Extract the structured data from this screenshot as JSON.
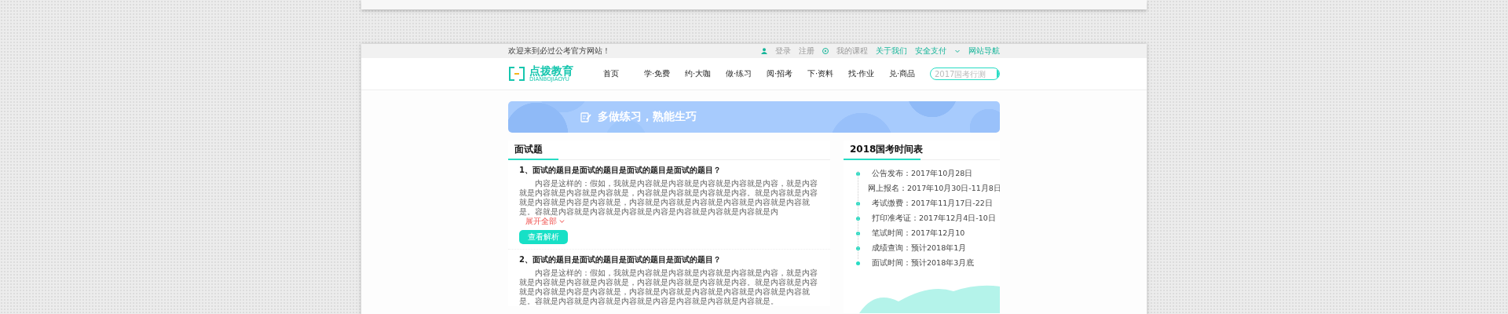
{
  "top_bar": {
    "welcome": "欢迎来到必过公考官方网站！",
    "links": [
      {
        "label": "登录",
        "kind": "user"
      },
      {
        "label": "注册",
        "kind": "plain"
      },
      {
        "label": "我的课程",
        "kind": "play"
      },
      {
        "label": "关于我们",
        "kind": "accent"
      },
      {
        "label": "安全支付",
        "kind": "accent"
      },
      {
        "label": "网站导航",
        "kind": "menu"
      }
    ]
  },
  "header": {
    "logo": {
      "name": "点拨教育",
      "subtitle": "DIANBOJIAOYU"
    },
    "nav": [
      "首页",
      "学·免费",
      "约·大咖",
      "做·练习",
      "阅·招考",
      "下·资料",
      "找·作业",
      "兑·商品"
    ],
    "search": {
      "placeholder": "2017国考行测"
    }
  },
  "banner": {
    "title": "多做练习，熟能生巧"
  },
  "questions_panel": {
    "title": "面试题",
    "questions": [
      {
        "title": "1、面试的题目是面试的题目是面试的题目是面试的题目？",
        "body": "内容是这样的：假如，我就是内容就是内容就是内容就是内容就是内容，就是内容就是内容就是内容就是内容就是，内容就是内容就是内容就是内容。就是内容就是内容就是内容就是内容是内容就是，内容就是内容就是内容就是内容就是内容就是内容就是。容就是内容就是内容就是内容就是内容是内容就是内容就是内容就是内",
        "expand_link": "展开全部",
        "analysis_button": "查看解析"
      },
      {
        "title": "2、面试的题目是面试的题目是面试的题目是面试的题目？",
        "body": "内容是这样的：假如，我就是内容就是内容就是内容就是内容就是内容，就是内容就是内容就是内容就是内容就是，内容就是内容就是内容就是内容。就是内容就是内容就是内容就是内容是内容就是，内容就是内容就是内容就是内容就是内容就是内容就是。容就是内容就是内容就是内容就是内容是内容就是内容就是内容就是。"
      }
    ]
  },
  "schedule_panel": {
    "title": "2018国考时间表",
    "items": [
      "公告发布：2017年10月28日",
      "网上报名：2017年10月30日-11月8日",
      "考试缴费：2017年11月17日-22日",
      "打印准考证：2017年12月4日-10日",
      "笔试时间：2017年12月10",
      "成绩查询：预计2018年1月",
      "面试时间：预计2018年3月底"
    ]
  }
}
